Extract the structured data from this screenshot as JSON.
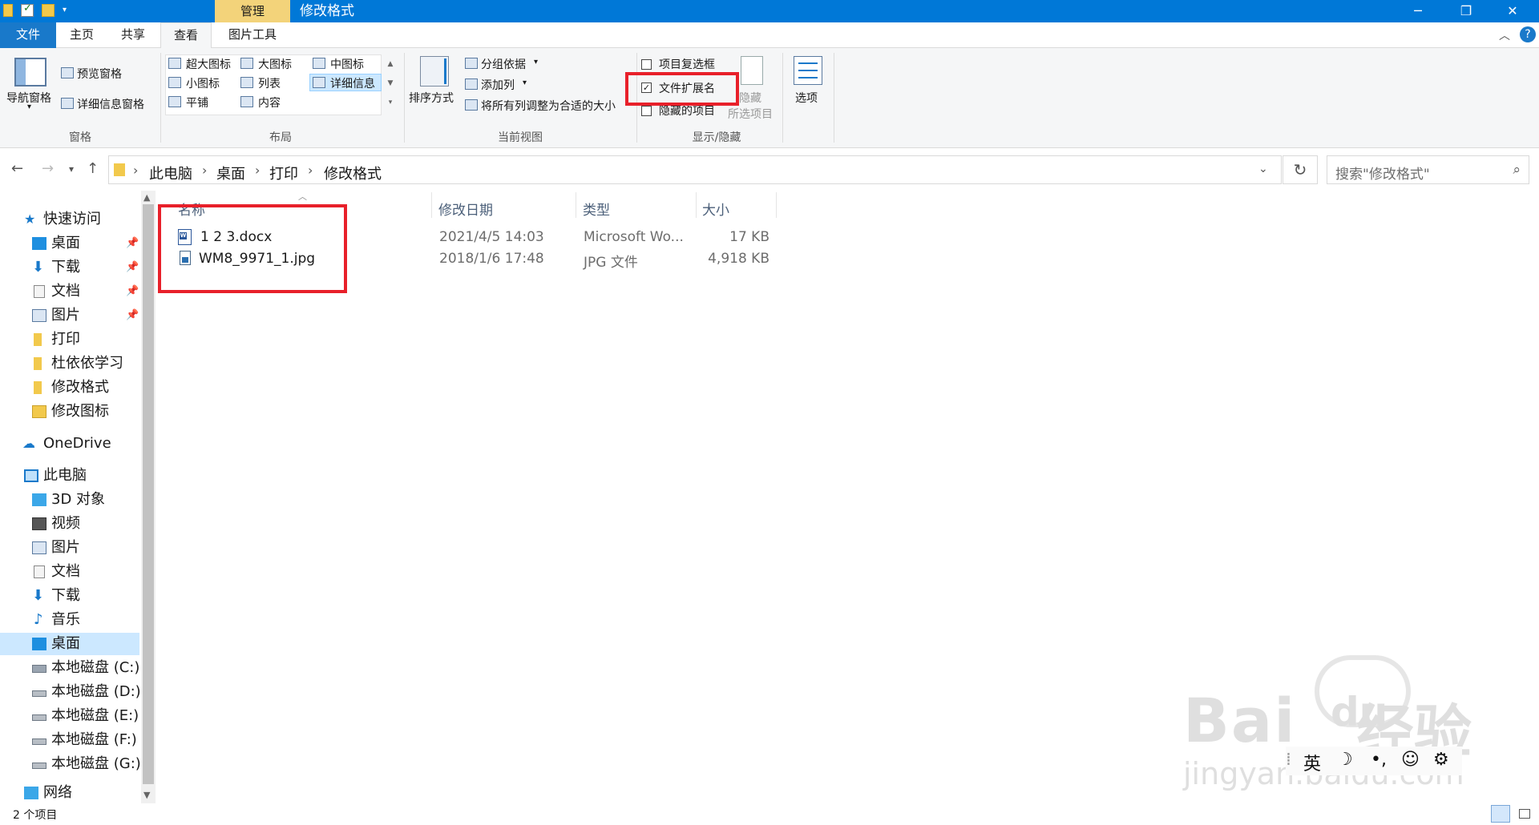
{
  "window": {
    "title": "修改格式",
    "context_tab": "管理",
    "controls": {
      "minimize": "─",
      "maximize": "❐",
      "close": "✕"
    }
  },
  "ribbon_tabs": [
    "文件",
    "主页",
    "共享",
    "查看",
    "图片工具"
  ],
  "ribbon": {
    "panes": {
      "nav_pane": "导航窗格",
      "preview_pane": "预览窗格",
      "details_pane": "详细信息窗格",
      "group": "窗格"
    },
    "layout": {
      "extra_large": "超大图标",
      "large": "大图标",
      "medium": "中图标",
      "small": "小图标",
      "list": "列表",
      "details": "详细信息",
      "tiles": "平铺",
      "content": "内容",
      "group": "布局"
    },
    "current_view": {
      "sort": "排序方式",
      "group_by": "分组依据",
      "add_columns": "添加列",
      "size_all": "将所有列调整为合适的大小",
      "group": "当前视图"
    },
    "show_hide": {
      "item_checkbox": "项目复选框",
      "file_ext": "文件扩展名",
      "hidden_items": "隐藏的项目",
      "hide_selected_1": "隐藏",
      "hide_selected_2": "所选项目",
      "group": "显示/隐藏",
      "file_ext_checked": true
    },
    "options": "选项"
  },
  "address": {
    "crumbs": [
      "此电脑",
      "桌面",
      "打印",
      "修改格式"
    ],
    "search_placeholder": "搜索\"修改格式\""
  },
  "nav": {
    "quick_access": "快速访问",
    "quick_items": [
      "桌面",
      "下载",
      "文档",
      "图片",
      "打印",
      "杜依依学习",
      "修改格式",
      "修改图标"
    ],
    "onedrive": "OneDrive",
    "this_pc": "此电脑",
    "pc_items": [
      "3D 对象",
      "视频",
      "图片",
      "文档",
      "下载",
      "音乐",
      "桌面",
      "本地磁盘 (C:)",
      "本地磁盘 (D:)",
      "本地磁盘 (E:)",
      "本地磁盘 (F:)",
      "本地磁盘 (G:)"
    ],
    "network": "网络"
  },
  "columns": [
    "名称",
    "修改日期",
    "类型",
    "大小"
  ],
  "files": [
    {
      "name": "1 2 3.docx",
      "date": "2021/4/5 14:03",
      "type": "Microsoft Wo...",
      "size": "17 KB"
    },
    {
      "name": "WM8_9971_1.jpg",
      "date": "2018/1/6 17:48",
      "type": "JPG 文件",
      "size": "4,918 KB"
    }
  ],
  "status": {
    "count": "2 个项目"
  },
  "ime": {
    "lang": "英",
    "moon": "☽",
    "punct": "•,",
    "emoji": "☺",
    "gear": "⚙"
  },
  "watermark": {
    "brand": "Bai",
    "du": "du",
    "cn": "经验",
    "url": "jingyan.baidu.com"
  },
  "colors": {
    "titlebar": "#0078d7",
    "highlight": "#e8202a",
    "selection": "#cce8ff",
    "manage_tab": "#f3d37a"
  }
}
